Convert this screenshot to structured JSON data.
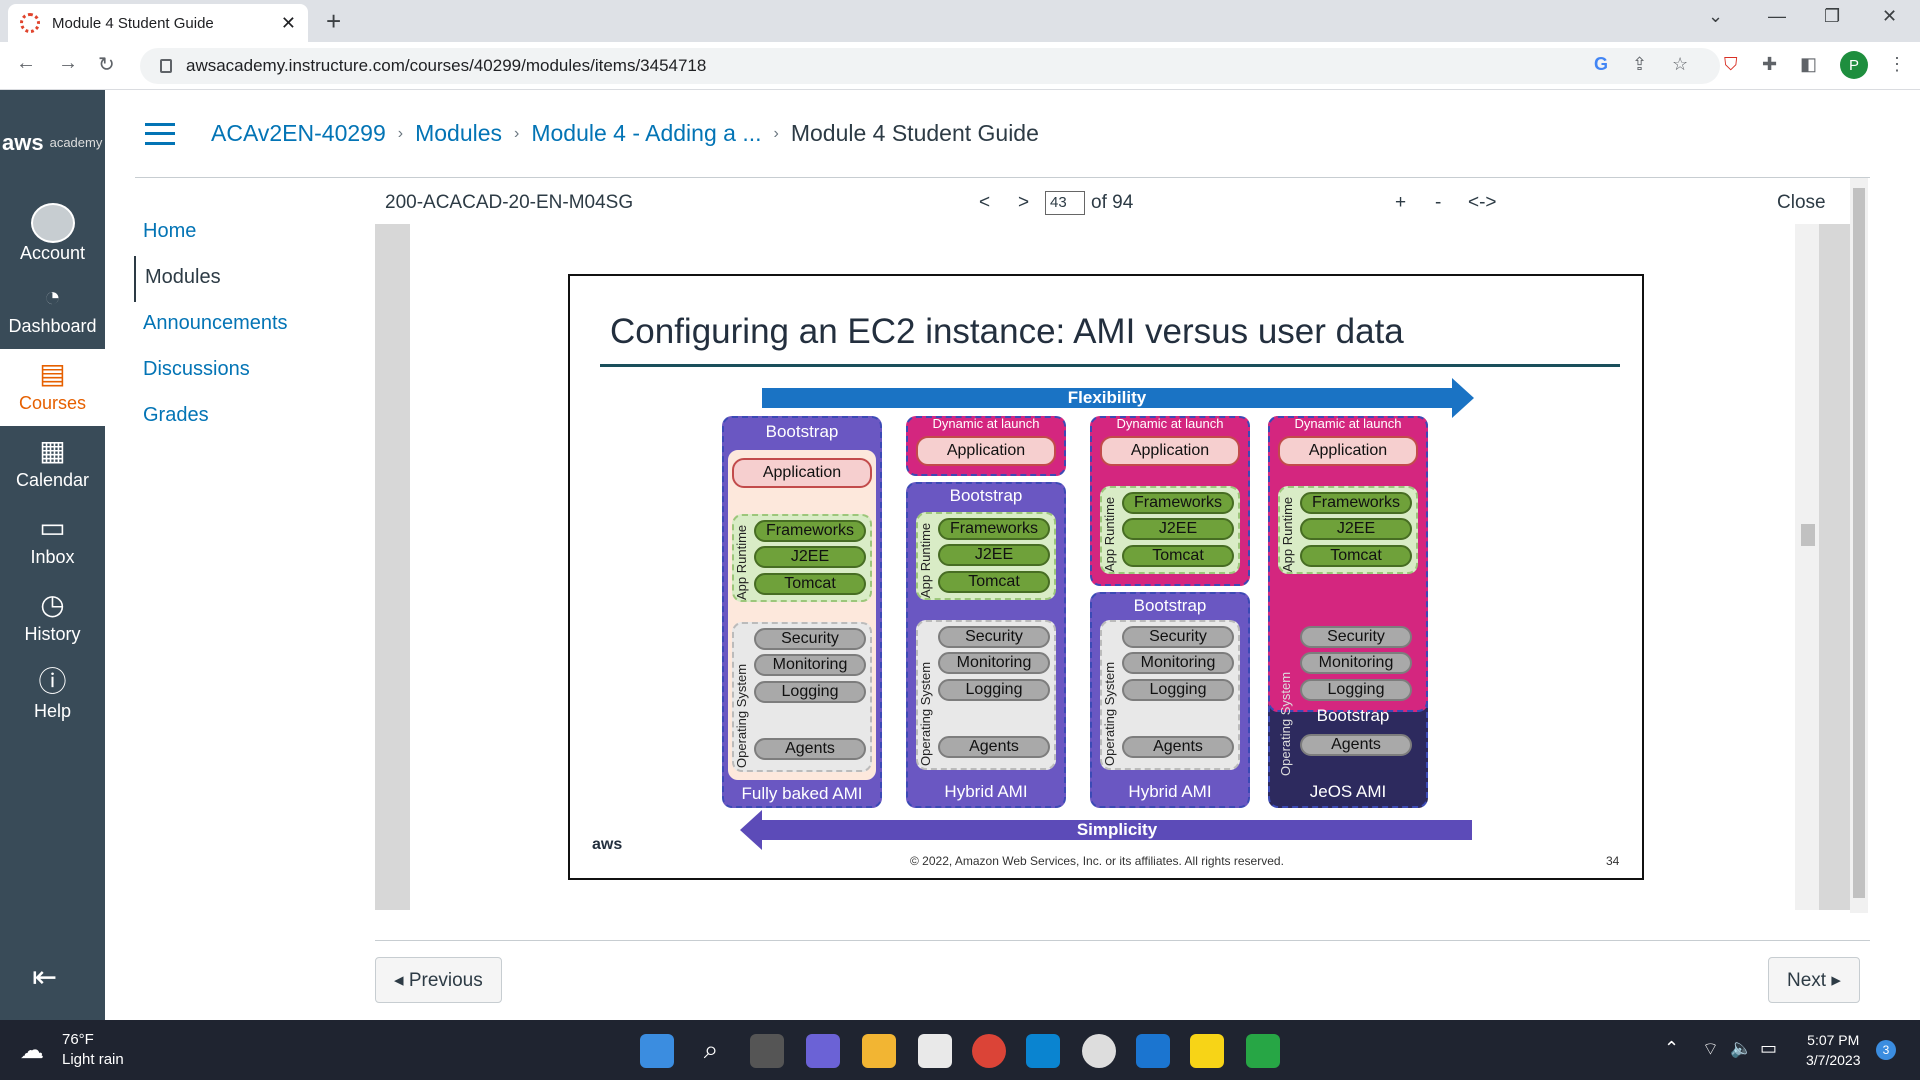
{
  "browser": {
    "tab_title": "Module 4 Student Guide",
    "url": "awsacademy.instructure.com/courses/40299/modules/items/3454718",
    "profile_initial": "P"
  },
  "global_nav": {
    "logo_main": "aws",
    "logo_sub": "academy",
    "items": [
      {
        "label": "Account",
        "icon": "account-icon"
      },
      {
        "label": "Dashboard",
        "icon": "dashboard-icon"
      },
      {
        "label": "Courses",
        "icon": "courses-icon",
        "active": true
      },
      {
        "label": "Calendar",
        "icon": "calendar-icon"
      },
      {
        "label": "Inbox",
        "icon": "inbox-icon"
      },
      {
        "label": "History",
        "icon": "history-icon"
      },
      {
        "label": "Help",
        "icon": "help-icon"
      }
    ]
  },
  "breadcrumb": [
    "ACAv2EN-40299",
    "Modules",
    "Module 4 - Adding a ...",
    "Module 4 Student Guide"
  ],
  "course_nav": [
    "Home",
    "Modules",
    "Announcements",
    "Discussions",
    "Grades"
  ],
  "viewer": {
    "doc_name": "200-ACACAD-20-EN-M04SG",
    "prev": "<",
    "next": ">",
    "page": "43",
    "of": "of 94",
    "zoom_in": "+",
    "zoom_out": "-",
    "fit": "<->",
    "close": "Close"
  },
  "slide": {
    "title": "Configuring an EC2 instance: AMI versus user data",
    "flexibility": "Flexibility",
    "simplicity": "Simplicity",
    "copyright": "© 2022, Amazon Web Services, Inc. or its affiliates. All rights reserved.",
    "page_no": "34",
    "aws_logo": "aws",
    "columns": [
      {
        "top_label": "Bootstrap",
        "application": "Application",
        "runtime": "App Runtime",
        "os": "Operating System",
        "footer": "Fully baked AMI"
      },
      {
        "top_label": "Dynamic at launch",
        "application": "Application",
        "bootstrap": "Bootstrap",
        "runtime": "App Runtime",
        "os": "Operating System",
        "footer": "Hybrid AMI"
      },
      {
        "top_label": "Dynamic at launch",
        "application": "Application",
        "bootstrap": "Bootstrap",
        "runtime": "App Runtime",
        "os": "Operating System",
        "footer": "Hybrid AMI"
      },
      {
        "top_label": "Dynamic at launch",
        "application": "Application",
        "bootstrap": "Bootstrap",
        "runtime": "App Runtime",
        "os": "Operating System",
        "footer": "JeOS AMI"
      }
    ],
    "runtime_items": [
      "Frameworks",
      "J2EE",
      "Tomcat"
    ],
    "os_items": [
      "Security",
      "Monitoring",
      "Logging",
      "Agents"
    ]
  },
  "footer": {
    "previous": "◂ Previous",
    "next": "Next ▸"
  },
  "taskbar": {
    "temp": "76°F",
    "weather": "Light rain",
    "time": "5:07 PM",
    "date": "3/7/2023",
    "badge": "3"
  }
}
